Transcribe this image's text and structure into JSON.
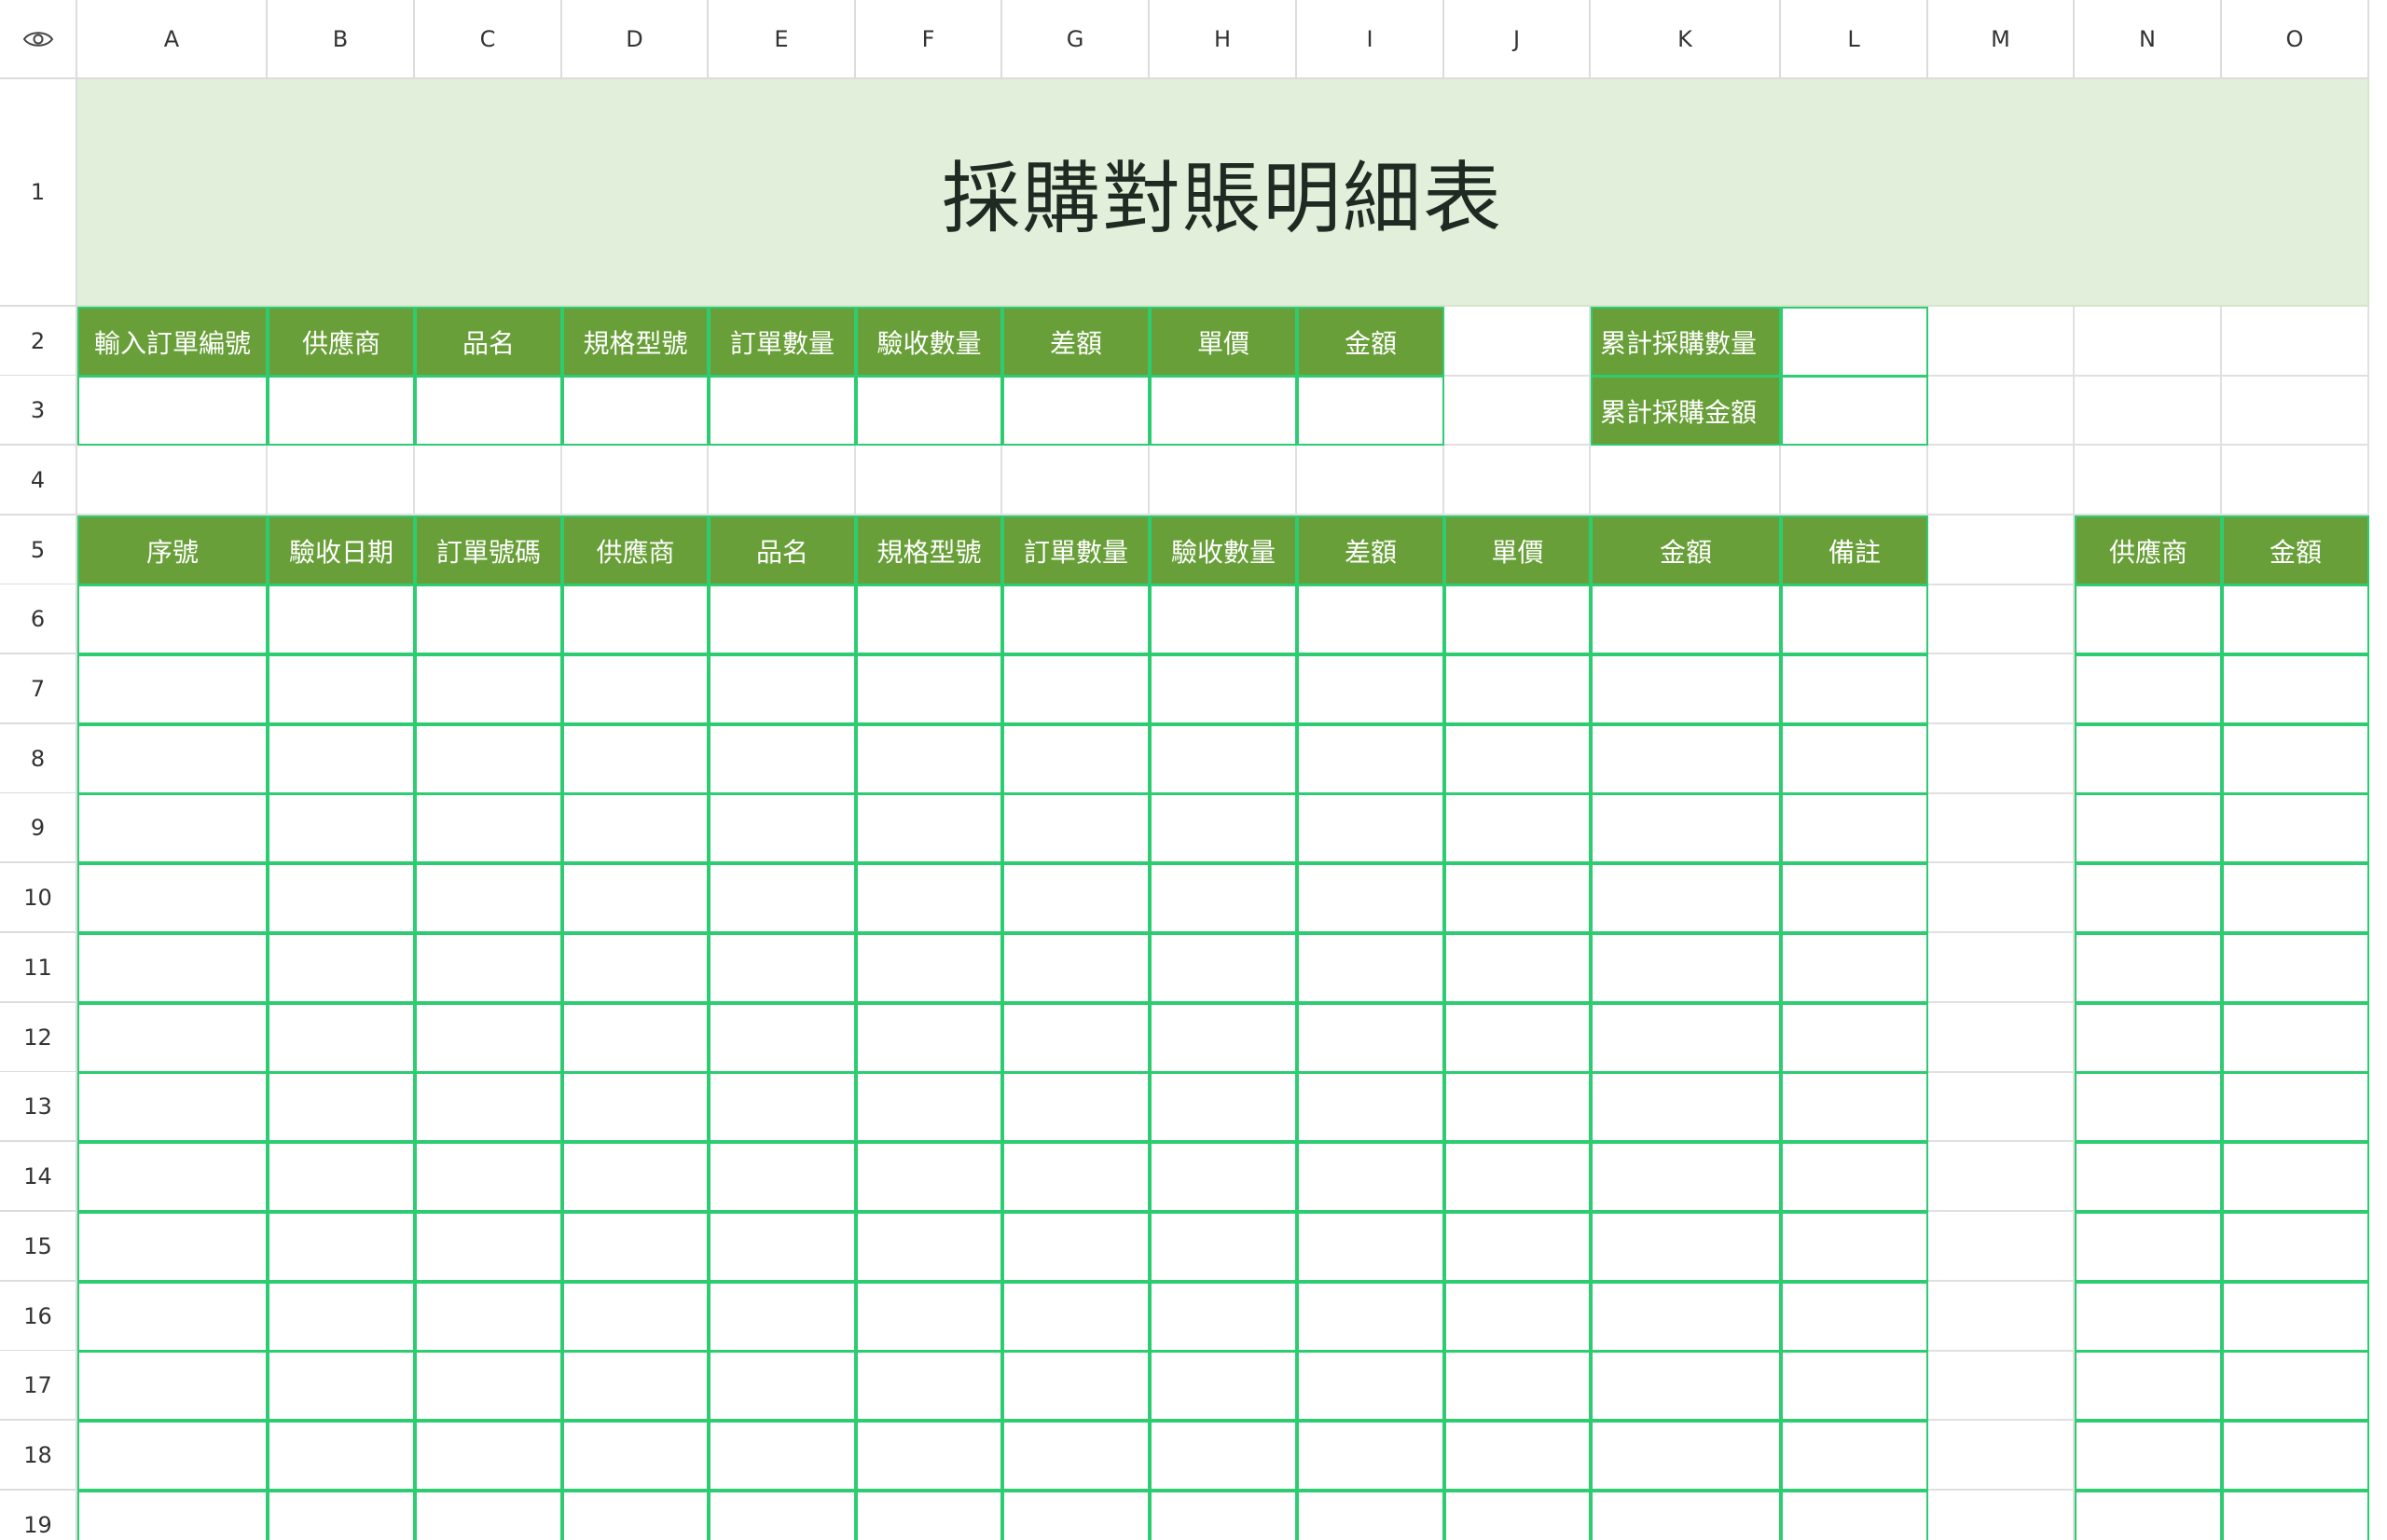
{
  "sheet": {
    "title": "採購對賬明細表",
    "accent_color": "#689f38",
    "title_bg": "#e2efda",
    "border_color": "#2ecc71",
    "corner_icon": "eye-icon",
    "columns": [
      "A",
      "B",
      "C",
      "D",
      "E",
      "F",
      "G",
      "H",
      "I",
      "J",
      "K",
      "L",
      "M",
      "N",
      "O"
    ],
    "rows": [
      "1",
      "2",
      "3",
      "4",
      "5",
      "6",
      "7",
      "8",
      "9",
      "10",
      "11",
      "12",
      "13",
      "14",
      "15",
      "16",
      "17",
      "18",
      "19"
    ],
    "input_headers": [
      "輸入訂單編號",
      "供應商",
      "品名",
      "規格型號",
      "訂單數量",
      "驗收數量",
      "差額",
      "單價",
      "金額"
    ],
    "summary_labels": [
      "累計採購數量",
      "累計採購金額"
    ],
    "detail_headers": [
      "序號",
      "驗收日期",
      "訂單號碼",
      "供應商",
      "品名",
      "規格型號",
      "訂單數量",
      "驗收數量",
      "差額",
      "單價",
      "金額",
      "備註"
    ],
    "side_headers": [
      "供應商",
      "金額"
    ]
  }
}
